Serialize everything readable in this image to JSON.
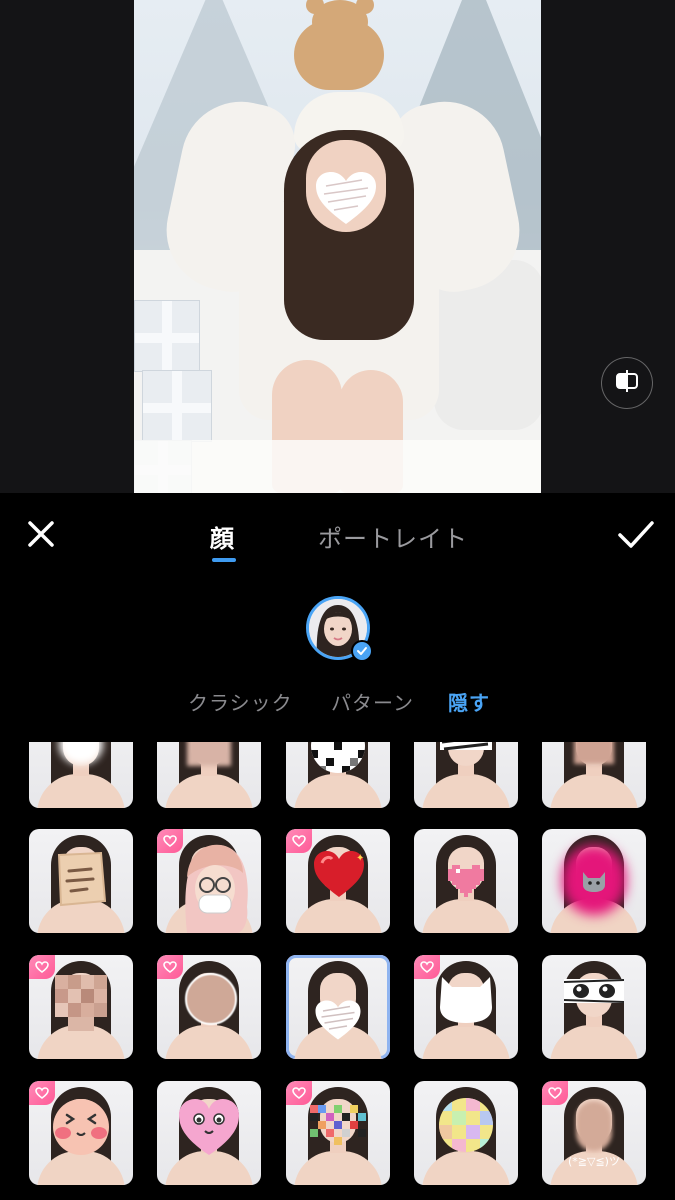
{
  "toolbar": {
    "close_icon": "close-icon",
    "confirm_icon": "check-icon",
    "tabs": [
      {
        "label": "顔",
        "active": true
      },
      {
        "label": "ポートレイト",
        "active": false
      }
    ]
  },
  "subtabs": [
    {
      "label": "クラシック",
      "active": false
    },
    {
      "label": "パターン",
      "active": false
    },
    {
      "label": "隠す",
      "active": true
    }
  ],
  "accent_color": "#4aa4f5",
  "premium_color": "#ff5a96",
  "grid": {
    "items": [
      {
        "name": "mask-blur-white",
        "premium": false
      },
      {
        "name": "mask-blur-rect",
        "premium": false
      },
      {
        "name": "mask-mosaic-bw",
        "premium": false
      },
      {
        "name": "mask-scribble-eyes",
        "premium": false
      },
      {
        "name": "mask-blur-tall",
        "premium": false
      },
      {
        "name": "mask-sticky-note",
        "premium": false
      },
      {
        "name": "mask-glasses-girl",
        "premium": true
      },
      {
        "name": "mask-red-heart",
        "premium": true
      },
      {
        "name": "mask-pixel-heart",
        "premium": false
      },
      {
        "name": "mask-pink-cat",
        "premium": false
      },
      {
        "name": "mask-mosaic-skin",
        "premium": true
      },
      {
        "name": "mask-circle-blur",
        "premium": true
      },
      {
        "name": "mask-white-heart",
        "premium": false,
        "selected": true
      },
      {
        "name": "mask-white-cat",
        "premium": true
      },
      {
        "name": "mask-manga-eyes",
        "premium": false
      },
      {
        "name": "mask-blush-face",
        "premium": true
      },
      {
        "name": "mask-pink-heart-face",
        "premium": false
      },
      {
        "name": "mask-color-mosaic",
        "premium": true
      },
      {
        "name": "mask-pastel-circle",
        "premium": false
      },
      {
        "name": "mask-kaomoji",
        "premium": true,
        "text": "(*≧▽≦)ツ"
      }
    ]
  }
}
